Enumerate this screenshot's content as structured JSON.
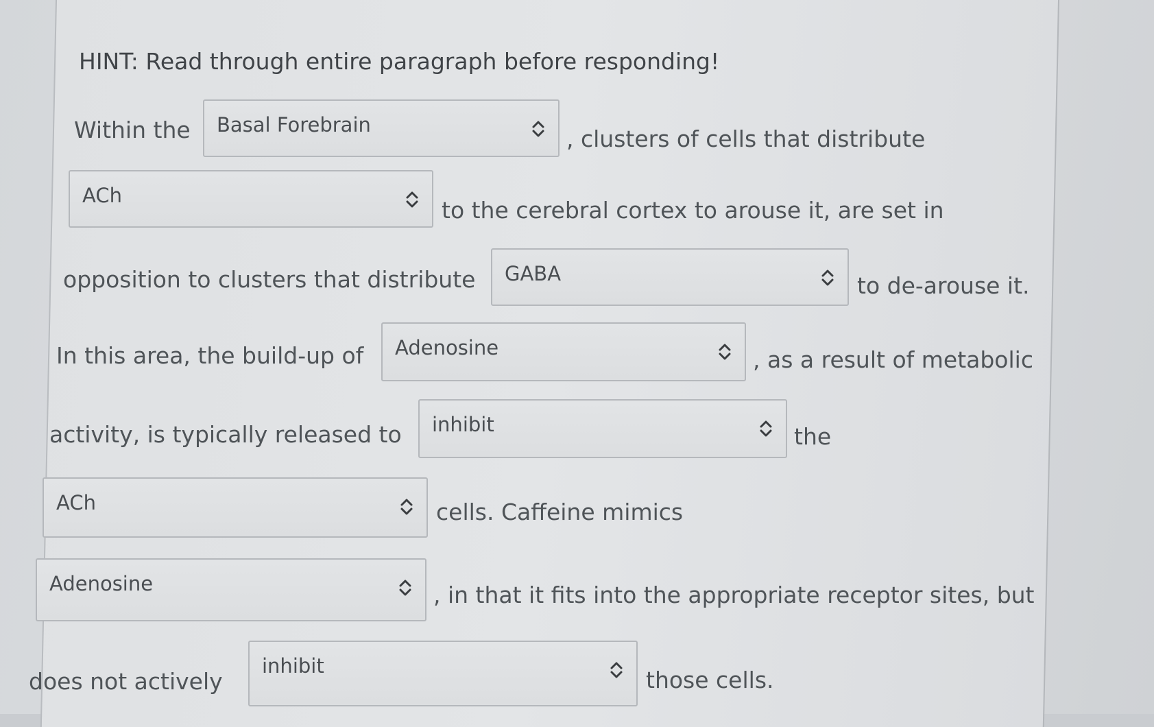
{
  "hint": "HINT: Read through entire paragraph before responding!",
  "rows": [
    {
      "before": "Within the",
      "select": "Basal Forebrain",
      "after": ", clusters of cells that distribute"
    },
    {
      "before": "",
      "select": "ACh",
      "after": "to the cerebral cortex to arouse it, are set in"
    },
    {
      "before": "opposition to clusters that distribute",
      "select": "GABA",
      "after": "to de-arouse it."
    },
    {
      "before": "In this area, the build-up of",
      "select": "Adenosine",
      "after": ", as a result of metabolic"
    },
    {
      "before": "activity, is typically released to",
      "select": "inhibit",
      "after": "the"
    },
    {
      "before": "",
      "select": "ACh",
      "after": "cells. Caffeine mimics"
    },
    {
      "before": "",
      "select": "Adenosine",
      "after": ", in that it fits into the appropriate receptor sites, but"
    },
    {
      "before": "does not actively",
      "select": "inhibit",
      "after": "those cells."
    }
  ],
  "icons": {
    "select_arrow": "chevron-up-down-icon"
  }
}
